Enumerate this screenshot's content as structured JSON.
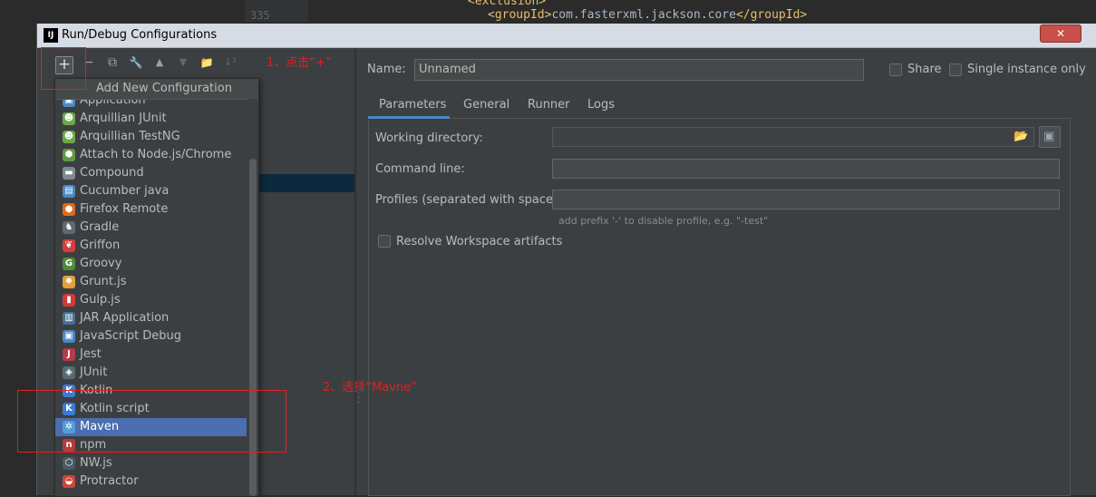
{
  "editor": {
    "line_number": "335",
    "code_open": "<groupId>",
    "code_text": "com.fasterxml.jackson.core",
    "code_close": "</groupId>",
    "code_top": "<exclusion>"
  },
  "dialog": {
    "title": "Run/Debug Configurations",
    "app_icon": "IJ",
    "close_label": "✕"
  },
  "toolbar": {
    "add": "+",
    "remove": "−",
    "copy": "⧉",
    "settings": "🔧",
    "move_up": "▲",
    "move_down": "▼",
    "folder": "📁",
    "sort": "↓²"
  },
  "popup": {
    "header": "Add New Configuration",
    "items": [
      {
        "label": "Application",
        "icon": "application-icon",
        "color": "#4a88c7",
        "glyph": "▣"
      },
      {
        "label": "Arquillian JUnit",
        "icon": "arquillian-icon",
        "color": "#6aaa45",
        "glyph": "☻"
      },
      {
        "label": "Arquillian TestNG",
        "icon": "arquillian-icon",
        "color": "#6aaa45",
        "glyph": "☻"
      },
      {
        "label": "Attach to Node.js/Chrome",
        "icon": "attach-icon",
        "color": "#5c9a3f",
        "glyph": "⬢"
      },
      {
        "label": "Compound",
        "icon": "folder-icon",
        "color": "#7d8a8f",
        "glyph": "▬"
      },
      {
        "label": "Cucumber java",
        "icon": "cucumber-icon",
        "color": "#4a88c7",
        "glyph": "▤"
      },
      {
        "label": "Firefox Remote",
        "icon": "firefox-icon",
        "color": "#e06a1b",
        "glyph": "●"
      },
      {
        "label": "Gradle",
        "icon": "gradle-icon",
        "color": "#5f6b70",
        "glyph": "♞"
      },
      {
        "label": "Griffon",
        "icon": "griffon-icon",
        "color": "#d04040",
        "glyph": "❦"
      },
      {
        "label": "Groovy",
        "icon": "groovy-icon",
        "color": "#4c8d3c",
        "glyph": "G"
      },
      {
        "label": "Grunt.js",
        "icon": "grunt-icon",
        "color": "#e2a03a",
        "glyph": "✹"
      },
      {
        "label": "Gulp.js",
        "icon": "gulp-icon",
        "color": "#d03a3a",
        "glyph": "▮"
      },
      {
        "label": "JAR Application",
        "icon": "jar-icon",
        "color": "#4a6f95",
        "glyph": "▥"
      },
      {
        "label": "JavaScript Debug",
        "icon": "js-debug-icon",
        "color": "#4a88c7",
        "glyph": "▣"
      },
      {
        "label": "Jest",
        "icon": "jest-icon",
        "color": "#b53a4a",
        "glyph": "J"
      },
      {
        "label": "JUnit",
        "icon": "junit-icon",
        "color": "#5a6a74",
        "glyph": "◈"
      },
      {
        "label": "Kotlin",
        "icon": "kotlin-icon",
        "color": "#3a7bd5",
        "glyph": "K"
      },
      {
        "label": "Kotlin script",
        "icon": "kotlin-icon",
        "color": "#3a7bd5",
        "glyph": "K"
      },
      {
        "label": "Maven",
        "icon": "maven-gear-icon",
        "color": "#4f9fd8",
        "glyph": "✲"
      },
      {
        "label": "npm",
        "icon": "npm-icon",
        "color": "#b83a3a",
        "glyph": "n"
      },
      {
        "label": "NW.js",
        "icon": "nwjs-icon",
        "color": "#4a5a66",
        "glyph": "⬡"
      },
      {
        "label": "Protractor",
        "icon": "protractor-icon",
        "color": "#d0443a",
        "glyph": "◒"
      }
    ],
    "selected_index": 18
  },
  "form": {
    "name_label": "Name:",
    "name_value": "Unnamed",
    "share_label": "Share",
    "single_instance_label": "Single instance only",
    "tabs": [
      "Parameters",
      "General",
      "Runner",
      "Logs"
    ],
    "working_directory_label": "Working directory:",
    "working_directory_value": "",
    "command_line_label": "Command line:",
    "command_line_value": "",
    "profiles_label": "Profiles (separated with space):",
    "profiles_value": "",
    "profiles_hint": "add prefix '-' to disable profile, e.g. \"-test\"",
    "resolve_workspace_label": "Resolve Workspace artifacts"
  },
  "annotations": {
    "step1": "1、点击“+”",
    "step2": "2、选择“Mavne”"
  }
}
